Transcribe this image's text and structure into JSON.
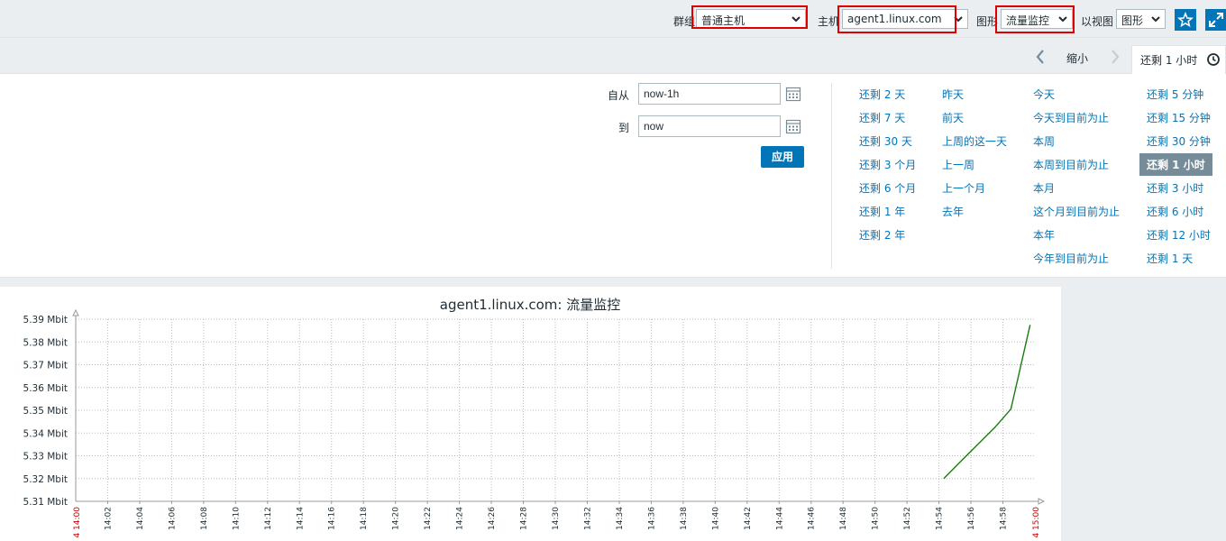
{
  "header": {
    "group_label": "群组",
    "group_value": "普通主机",
    "host_label": "主机",
    "host_value": "agent1.linux.com",
    "graph_label": "图形",
    "graph_value": "流量监控",
    "view_label": "以视图",
    "view_value": "图形",
    "favorite_icon": "star-icon",
    "fullscreen_icon": "fullscreen-icon"
  },
  "subnav": {
    "zoom_out": "缩小",
    "period_tab": "还剩 1 小时",
    "clock_icon": "clock-icon"
  },
  "filter": {
    "from_label": "自从",
    "from_value": "now-1h",
    "to_label": "到",
    "to_value": "now",
    "apply": "应用"
  },
  "quick_ranges": {
    "col1": [
      "还剩 2 天",
      "还剩 7 天",
      "还剩 30 天",
      "还剩 3 个月",
      "还剩 6 个月",
      "还剩 1 年",
      "还剩 2 年"
    ],
    "col2": [
      "昨天",
      "前天",
      "上周的这一天",
      "上一周",
      "上一个月",
      "去年"
    ],
    "col3": [
      "今天",
      "今天到目前为止",
      "本周",
      "本周到目前为止",
      "本月",
      "这个月到目前为止",
      "本年",
      "今年到目前为止"
    ],
    "col4": [
      "还剩 5 分钟",
      "还剩 15 分钟",
      "还剩 30 分钟",
      "还剩 1 小时",
      "还剩 3 小时",
      "还剩 6 小时",
      "还剩 12 小时",
      "还剩 1 天"
    ],
    "active": "还剩 1 小时"
  },
  "colors": {
    "accent": "#0275b8",
    "highlight_box": "#e00000",
    "series_line": "#1a7c11",
    "active_range_bg": "#768d99",
    "axis_red": "#cc0000"
  },
  "chart_data": {
    "type": "line",
    "title": "agent1.linux.com: 流量监控",
    "y_ticks": [
      "5.39 Mbit",
      "5.38 Mbit",
      "5.37 Mbit",
      "5.36 Mbit",
      "5.35 Mbit",
      "5.34 Mbit",
      "5.33 Mbit",
      "5.32 Mbit",
      "5.31 Mbit"
    ],
    "ylim": [
      5.31,
      5.39
    ],
    "x_start_label": "4 14:00",
    "x_end_label": "4 15:00",
    "x_ticks": [
      "14:02",
      "14:04",
      "14:06",
      "14:08",
      "14:10",
      "14:12",
      "14:14",
      "14:16",
      "14:18",
      "14:20",
      "14:22",
      "14:24",
      "14:26",
      "14:28",
      "14:30",
      "14:32",
      "14:34",
      "14:36",
      "14:38",
      "14:40",
      "14:42",
      "14:44",
      "14:46",
      "14:48",
      "14:50",
      "14:52",
      "14:54",
      "14:56",
      "14:58"
    ],
    "xlim_minutes": [
      0,
      60
    ],
    "grid": true,
    "series": [
      {
        "x_minutes": [
          54.3,
          55.5,
          56.5,
          57.5,
          58.5,
          59.7
        ],
        "values": [
          5.32,
          5.3285,
          5.3355,
          5.3425,
          5.3505,
          5.3875
        ]
      }
    ]
  }
}
